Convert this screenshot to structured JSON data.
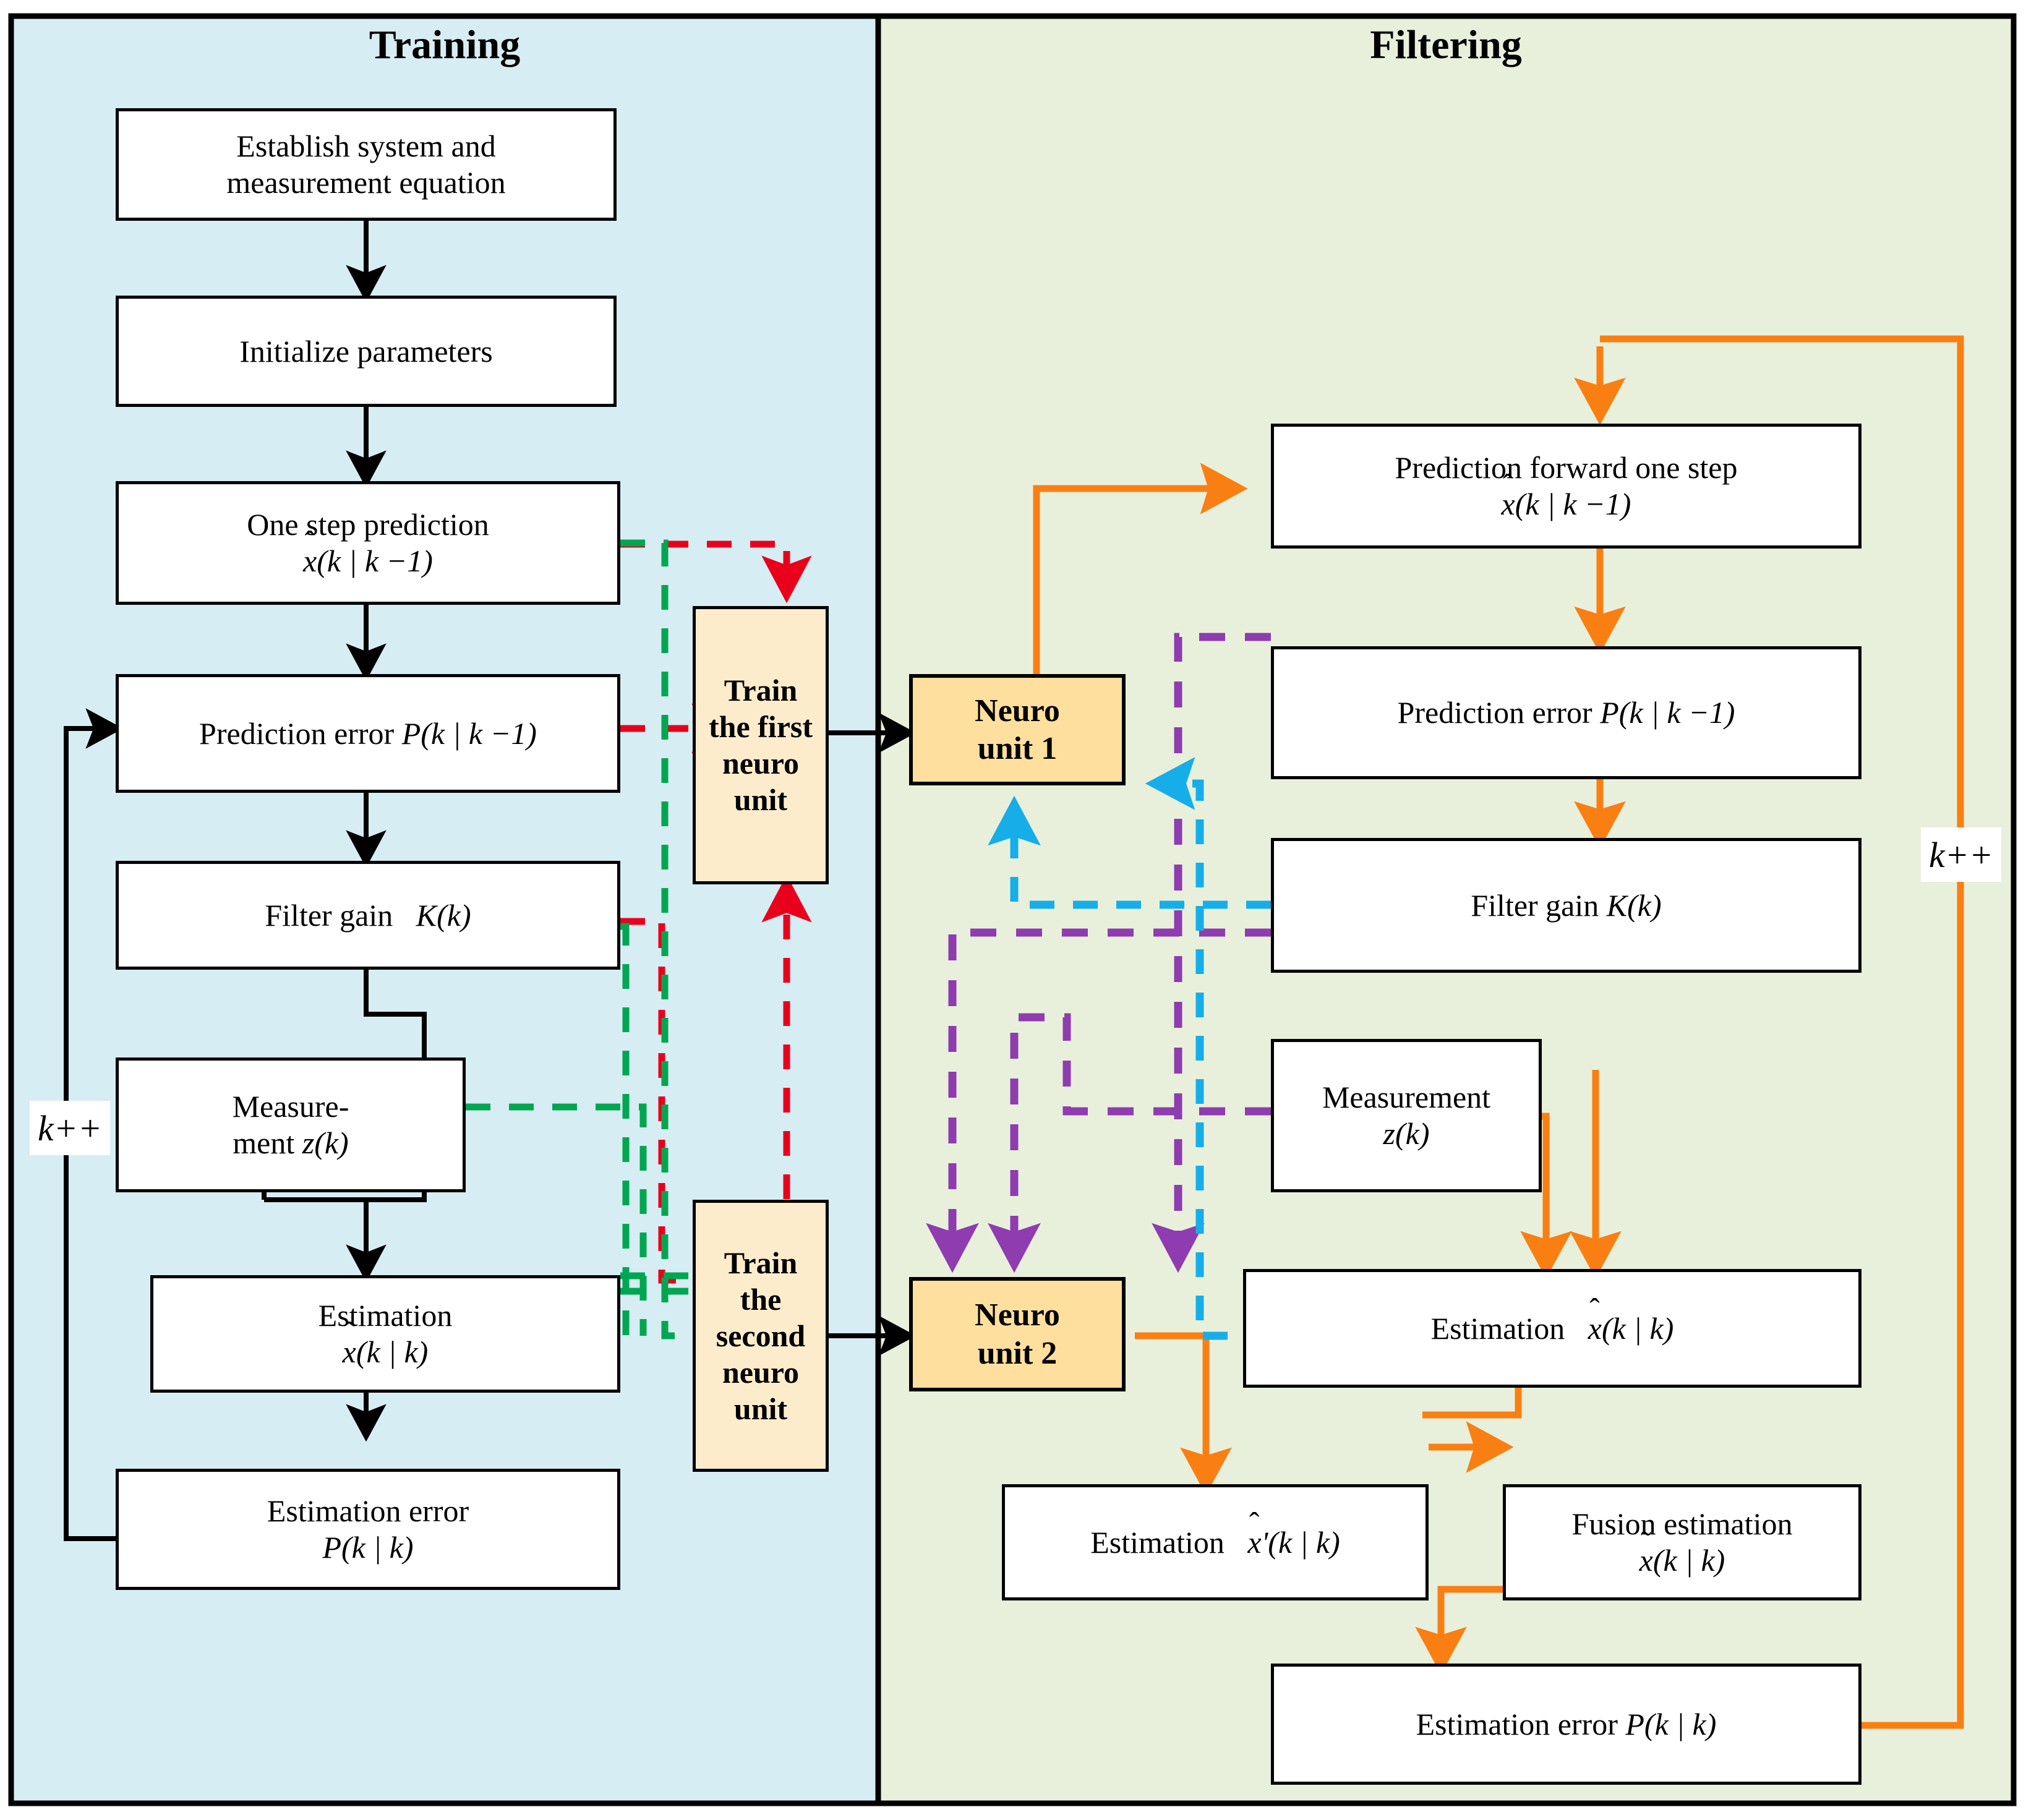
{
  "diagram": {
    "title": "Neuro-assisted Kalman filtering flowchart",
    "panels": {
      "left": {
        "label": "Training",
        "bg": "#d6edf3"
      },
      "right": {
        "label": "Filtering",
        "bg": "#e8f0dc"
      }
    },
    "colors": {
      "black": "#000000",
      "red_dashed": "#e8001c",
      "green_dashed": "#00a650",
      "orange": "#fa7f12",
      "purple_dashed": "#8e3cb0",
      "cyan_dashed": "#16aee8",
      "neuro_fill": "#ffdf9e",
      "train_fill": "#fdeccc",
      "box_fill": "#ffffff"
    },
    "loop_labels": {
      "left": "k++",
      "right": "k++"
    },
    "training_nodes": [
      {
        "id": "establish",
        "lines": [
          "Establish system and",
          "measurement equation"
        ]
      },
      {
        "id": "init",
        "lines": [
          "Initialize parameters"
        ]
      },
      {
        "id": "one-step-pred",
        "lines": [
          "One step prediction",
          "x̂(k | k −1)"
        ]
      },
      {
        "id": "pred-error",
        "lines": [
          "Prediction error P(k | k −1)"
        ]
      },
      {
        "id": "filter-gain",
        "lines": [
          "Filter gain  K(k)"
        ]
      },
      {
        "id": "measurement",
        "lines": [
          "Measure-",
          "ment z(k)"
        ]
      },
      {
        "id": "estimation",
        "lines": [
          "Estimation",
          "x̂(k | k)"
        ]
      },
      {
        "id": "estimation-error",
        "lines": [
          "Estimation error",
          "P(k | k)"
        ]
      },
      {
        "id": "train-first",
        "lines": [
          "Train",
          "the first",
          "neuro",
          "unit"
        ]
      },
      {
        "id": "train-second",
        "lines": [
          "Train",
          "the",
          "second",
          "neuro",
          "unit"
        ]
      }
    ],
    "filtering_nodes": [
      {
        "id": "neuro-unit-1",
        "lines": [
          "Neuro",
          "unit 1"
        ]
      },
      {
        "id": "neuro-unit-2",
        "lines": [
          "Neuro",
          "unit 2"
        ]
      },
      {
        "id": "pred-forward",
        "lines": [
          "Prediction forward one step",
          "x̂(k | k −1)"
        ]
      },
      {
        "id": "pred-error-f",
        "lines": [
          "Prediction error P(k | k −1)"
        ]
      },
      {
        "id": "filter-gain-f",
        "lines": [
          "Filter gain K(k)"
        ]
      },
      {
        "id": "measurement-f",
        "lines": [
          "Measurement",
          "z(k)"
        ]
      },
      {
        "id": "estimation-f",
        "lines": [
          "Estimation  x̂(k | k)"
        ]
      },
      {
        "id": "estimation-prime",
        "lines": [
          "Estimation  x̂'(k | k)"
        ]
      },
      {
        "id": "fusion-estimation",
        "lines": [
          "Fusion estimation",
          "x̃(k | k)"
        ]
      },
      {
        "id": "estimation-error-f",
        "lines": [
          "Estimation error P(k | k)"
        ]
      }
    ],
    "text": {
      "establish_l1": "Establish system and",
      "establish_l2": "measurement equation",
      "init": "Initialize parameters",
      "one_step_l1": "One step prediction",
      "pred_error": "Prediction error",
      "filter_gain": "Filter gain",
      "measurement_l1": "Measure-",
      "measurement_l2": "ment ",
      "estimation": "Estimation",
      "estimation_error": "Estimation error",
      "train_first": "Train\nthe first\nneuro\nunit",
      "train_second": "Train\nthe\nsecond\nneuro\nunit",
      "neuro1_l1": "Neuro",
      "neuro1_l2": "unit 1",
      "neuro2_l1": "Neuro",
      "neuro2_l2": "unit 2",
      "pred_forward": "Prediction forward one step",
      "measurement_full": "Measurement",
      "fusion_estimation": "Fusion estimation",
      "kplusplus": "k++"
    }
  }
}
